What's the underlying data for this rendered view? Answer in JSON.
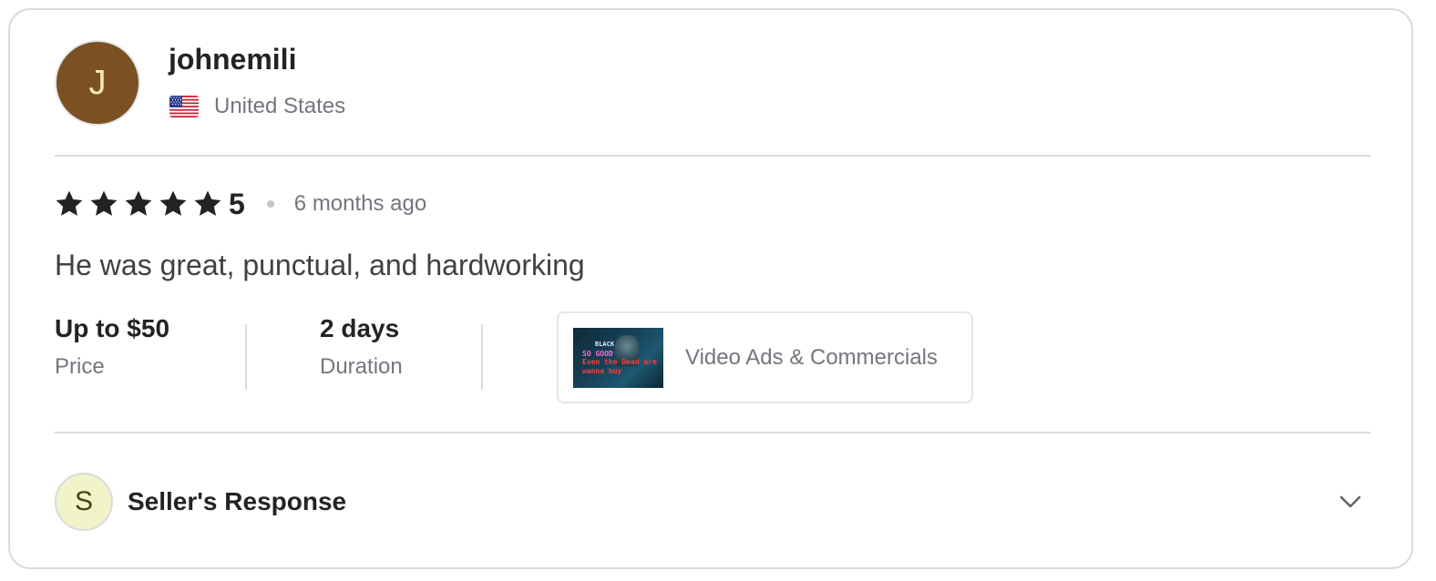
{
  "reviewer": {
    "initial": "J",
    "avatar_color": "#7b5022",
    "username": "johnemili",
    "country": "United States",
    "flag_icon": "us-flag-icon"
  },
  "review": {
    "stars": 5,
    "rating": "5",
    "time_ago": "6 months ago",
    "text": "He was great, punctual, and hardworking"
  },
  "stats": {
    "price_value": "Up to $50",
    "price_label": "Price",
    "duration_value": "2 days",
    "duration_label": "Duration"
  },
  "gig": {
    "title": "Video Ads & Commercials",
    "thumbnail_lines": [
      "BLACK",
      "SO GOOD",
      "Even the Dead are",
      "wanna buy"
    ]
  },
  "seller_response": {
    "initial": "S",
    "label": "Seller's Response",
    "toggle_icon": "chevron-down-icon"
  },
  "colors": {
    "border": "#dadbdd",
    "text_primary": "#222325",
    "text_secondary": "#74767e",
    "star": "#222325",
    "seller_avatar_bg": "#f1f4c8"
  }
}
